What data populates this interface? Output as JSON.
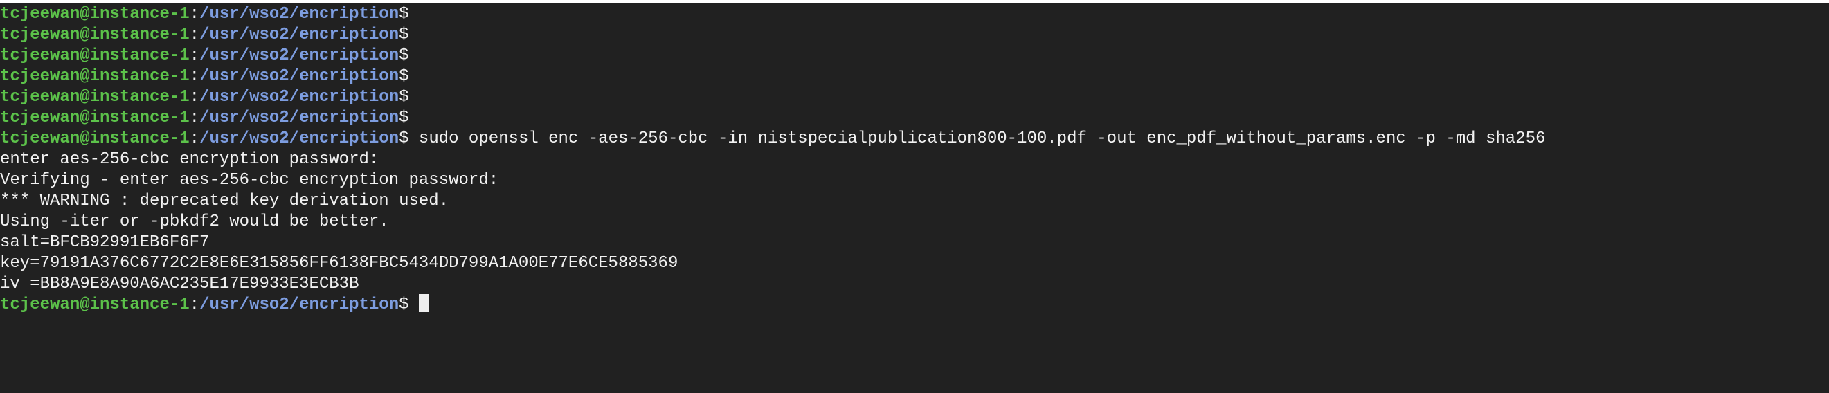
{
  "terminal": {
    "prompt": {
      "user_host": "tcjeewan@instance-1",
      "separator": ":",
      "path": "/usr/wso2/encription",
      "symbol": "$"
    },
    "empty_prompt_lines": 6,
    "command": " sudo openssl enc -aes-256-cbc -in nistspecialpublication800-100.pdf -out enc_pdf_without_params.enc -p -md sha256",
    "output": [
      "enter aes-256-cbc encryption password:",
      "Verifying - enter aes-256-cbc encryption password:",
      "*** WARNING : deprecated key derivation used.",
      "Using -iter or -pbkdf2 would be better.",
      "salt=BFCB92991EB6F6F7",
      "key=79191A376C6772C2E8E6E315856FF6138FBC5434DD799A1A00E77E6CE5885369",
      "iv =BB8A9E8A90A6AC235E17E9933E3ECB3B"
    ],
    "final_prompt_suffix": " ",
    "colors": {
      "background": "#212121",
      "user_host": "#5cc24a",
      "path": "#7d9de0",
      "text": "#f2f2f2",
      "cursor": "#eeeeee"
    }
  }
}
